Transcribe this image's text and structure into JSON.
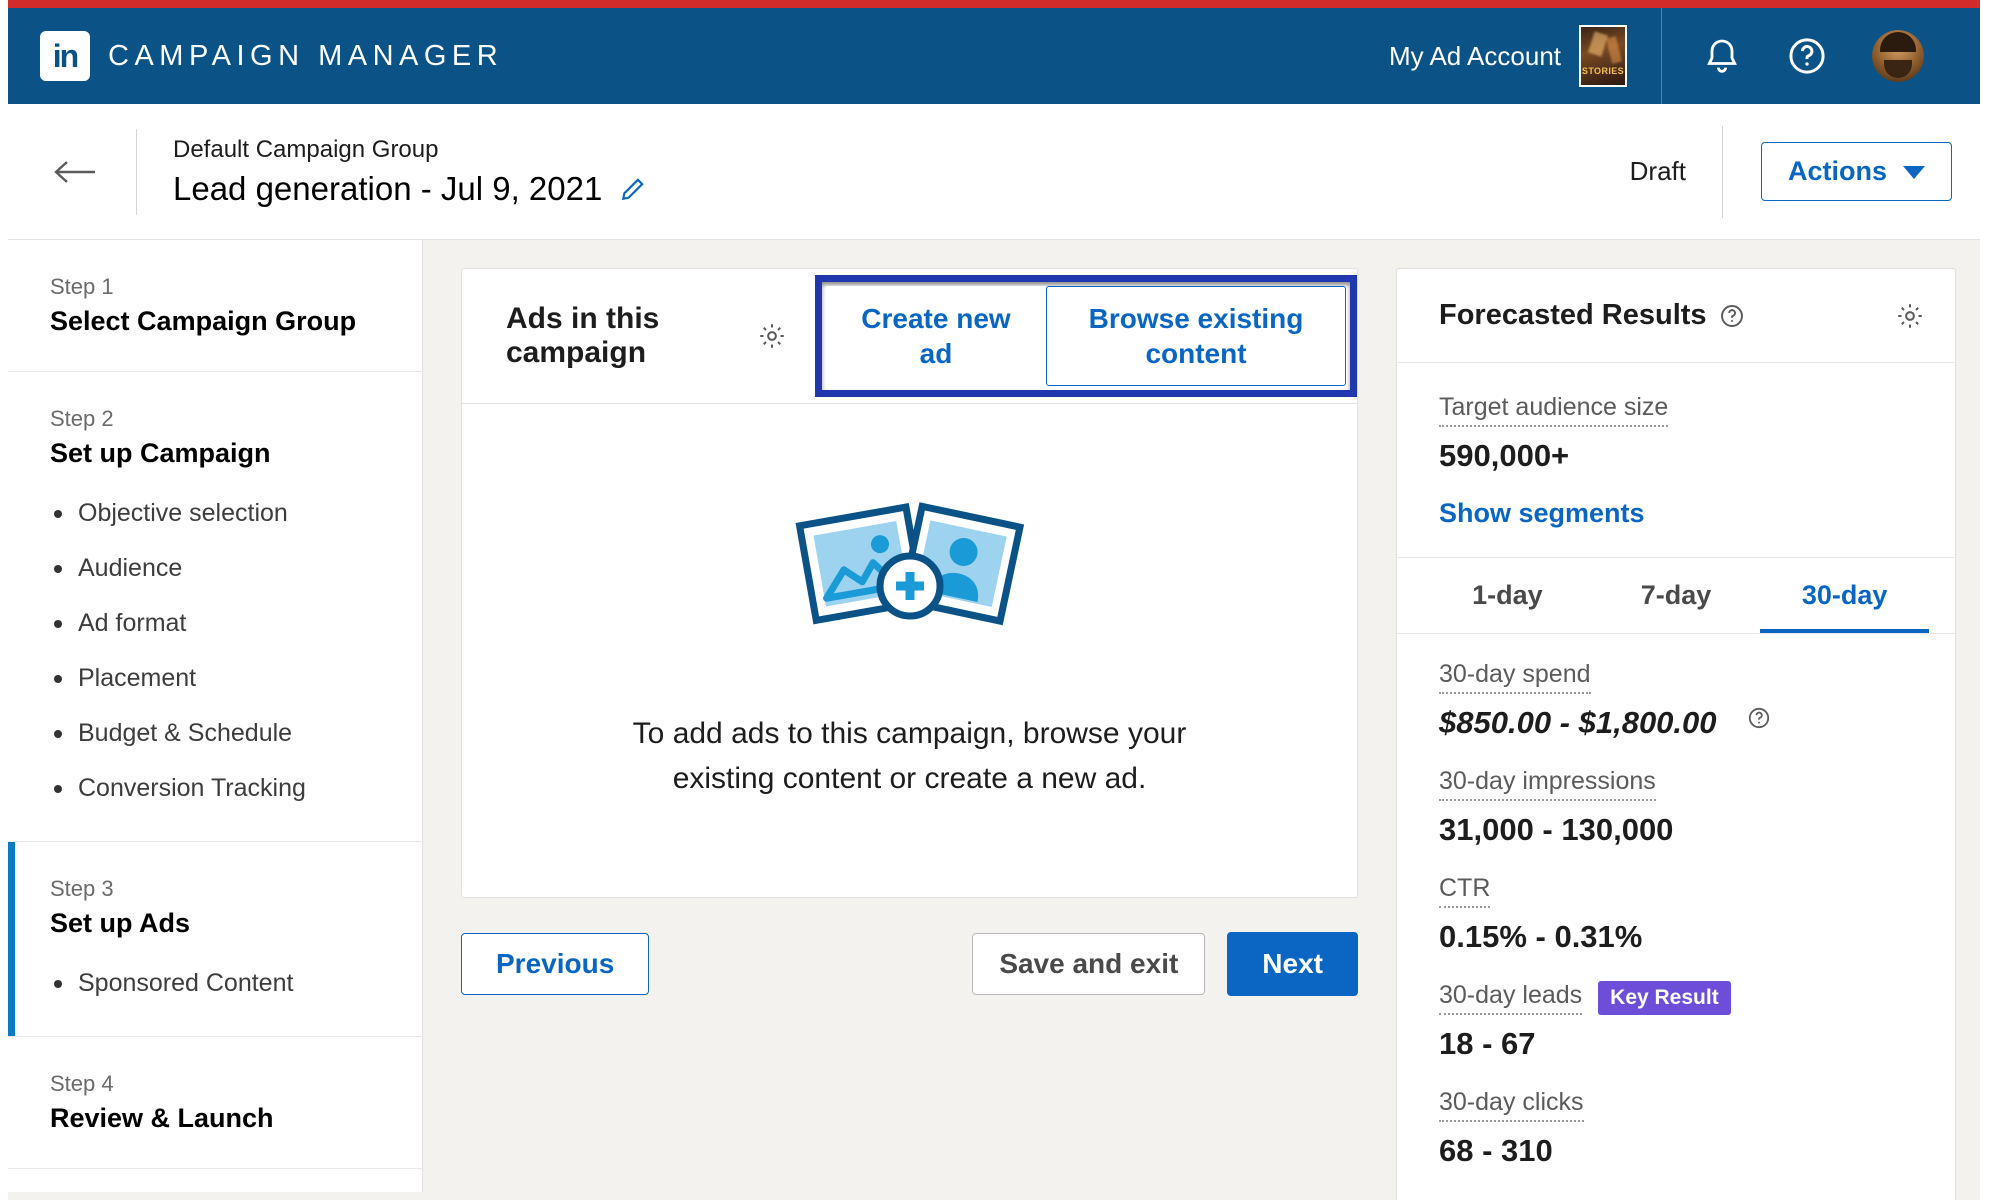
{
  "globalnav": {
    "brand": "CAMPAIGN MANAGER",
    "logo_text": "in",
    "account_name": "My Ad Account",
    "account_thumb_label": "STORIES",
    "notifications_icon": "bell-icon",
    "help_icon": "help-circle-icon",
    "avatar_icon": "user-avatar"
  },
  "campaign_header": {
    "back_icon": "back-arrow-icon",
    "group_label": "Default Campaign Group",
    "title": "Lead generation - Jul 9, 2021",
    "edit_icon": "pencil-icon",
    "status": "Draft",
    "actions_label": "Actions",
    "actions_caret": "chevron-down-icon"
  },
  "sidebar": {
    "steps": [
      {
        "num": "Step 1",
        "name": "Select Campaign Group",
        "substeps": [],
        "active": false
      },
      {
        "num": "Step 2",
        "name": "Set up Campaign",
        "substeps": [
          "Objective selection",
          "Audience",
          "Ad format",
          "Placement",
          "Budget & Schedule",
          "Conversion Tracking"
        ],
        "active": false
      },
      {
        "num": "Step 3",
        "name": "Set up Ads",
        "substeps": [
          "Sponsored Content"
        ],
        "active": true
      },
      {
        "num": "Step 4",
        "name": "Review & Launch",
        "substeps": [],
        "active": false
      }
    ]
  },
  "ads_card": {
    "title": "Ads in this campaign",
    "settings_icon": "gear-icon",
    "create_new_label": "Create new ad",
    "browse_existing_label": "Browse existing content",
    "empty_illustration": "photo-cards-plus-icon",
    "empty_text": "To add ads to this campaign, browse your existing content or create a new ad.",
    "highlight_color": "#2137ad"
  },
  "footer": {
    "previous_label": "Previous",
    "save_exit_label": "Save and exit",
    "next_label": "Next"
  },
  "forecast": {
    "title": "Forecasted Results",
    "help_icon": "help-circle-icon",
    "settings_icon": "gear-icon",
    "audience_label": "Target audience size",
    "audience_value": "590,000+",
    "show_segments_label": "Show segments",
    "tabs": [
      {
        "label": "1-day",
        "active": false
      },
      {
        "label": "7-day",
        "active": false
      },
      {
        "label": "30-day",
        "active": true
      }
    ],
    "metrics": [
      {
        "label": "30-day spend",
        "value": "$850.00 - $1,800.00",
        "italic": true,
        "help": true,
        "badge": ""
      },
      {
        "label": "30-day impressions",
        "value": "31,000 - 130,000",
        "italic": false,
        "help": false,
        "badge": ""
      },
      {
        "label": "CTR",
        "value": "0.15% - 0.31%",
        "italic": false,
        "help": false,
        "badge": ""
      },
      {
        "label": "30-day leads",
        "value": "18 - 67",
        "italic": false,
        "help": false,
        "badge": "Key Result"
      },
      {
        "label": "30-day clicks",
        "value": "68 - 310",
        "italic": false,
        "help": false,
        "badge": ""
      }
    ]
  }
}
